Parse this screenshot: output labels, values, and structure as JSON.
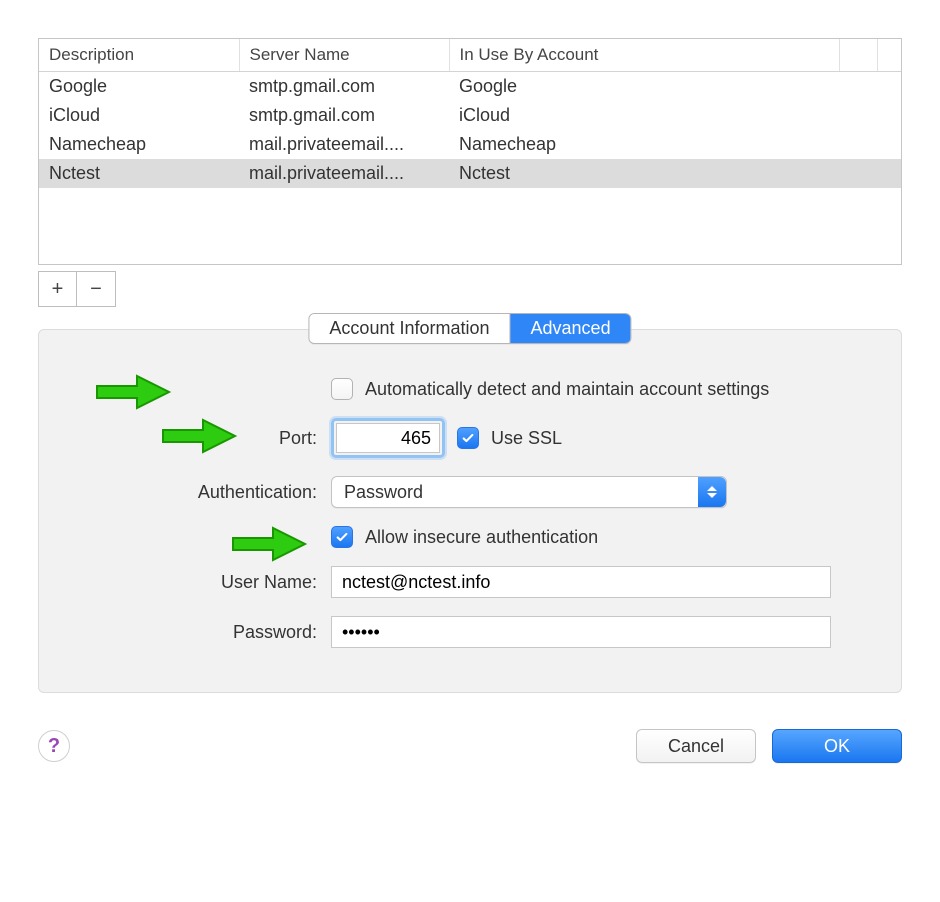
{
  "table": {
    "headers": {
      "description": "Description",
      "server": "Server Name",
      "account": "In Use By Account"
    },
    "rows": [
      {
        "description": "Google",
        "server": "smtp.gmail.com",
        "account": "Google",
        "selected": false
      },
      {
        "description": "iCloud",
        "server": "smtp.gmail.com",
        "account": "iCloud",
        "selected": false
      },
      {
        "description": "Namecheap",
        "server": "mail.privateemail....",
        "account": "Namecheap",
        "selected": false
      },
      {
        "description": "Nctest",
        "server": "mail.privateemail....",
        "account": "Nctest",
        "selected": true
      }
    ]
  },
  "addremove": {
    "add": "+",
    "remove": "−"
  },
  "tabs": {
    "info": "Account Information",
    "advanced": "Advanced",
    "active": "advanced"
  },
  "form": {
    "auto_detect": {
      "label": "Automatically detect and maintain account settings",
      "checked": false
    },
    "port": {
      "label": "Port:",
      "value": "465"
    },
    "use_ssl": {
      "label": "Use SSL",
      "checked": true
    },
    "authentication": {
      "label": "Authentication:",
      "value": "Password"
    },
    "allow_insecure": {
      "label": "Allow insecure authentication",
      "checked": true
    },
    "username": {
      "label": "User Name:",
      "value": "nctest@nctest.info"
    },
    "password": {
      "label": "Password:",
      "value": "••••••"
    }
  },
  "buttons": {
    "cancel": "Cancel",
    "ok": "OK",
    "help": "?"
  }
}
